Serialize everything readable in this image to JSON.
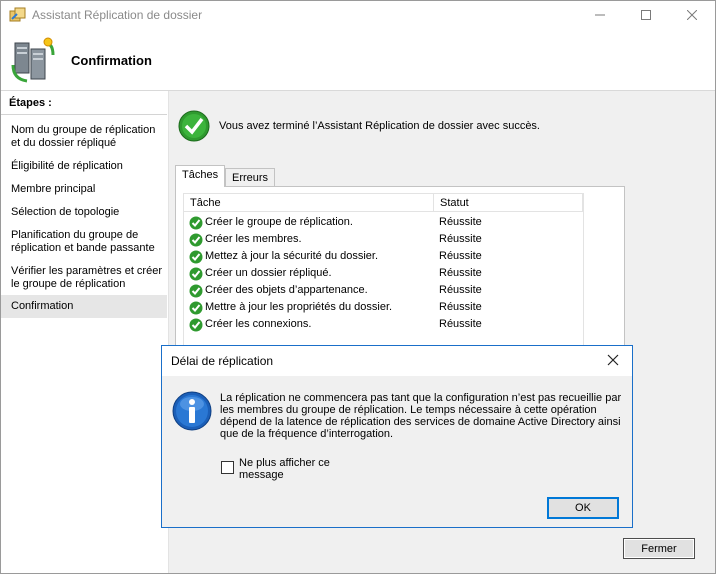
{
  "window": {
    "title": "Assistant Réplication de dossier",
    "minimize_icon": "minimize-icon",
    "maximize_icon": "maximize-icon",
    "close_icon": "close-icon"
  },
  "header": {
    "heading": "Confirmation",
    "icon": "replication-wizard-icon"
  },
  "sidebar": {
    "title": "Étapes :",
    "items": [
      {
        "label": "Nom du groupe de réplication et du dossier répliqué",
        "active": false
      },
      {
        "label": "Éligibilité de réplication",
        "active": false
      },
      {
        "label": "Membre principal",
        "active": false
      },
      {
        "label": "Sélection de topologie",
        "active": false
      },
      {
        "label": "Planification du groupe de réplication et bande passante",
        "active": false
      },
      {
        "label": "Vérifier les paramètres et créer le groupe de réplication",
        "active": false
      },
      {
        "label": "Confirmation",
        "active": true
      }
    ]
  },
  "main": {
    "success_message": "Vous avez terminé l’Assistant Réplication de dossier avec succès.",
    "success_icon": "success-check-icon",
    "tabs": [
      {
        "label": "Tâches",
        "selected": true
      },
      {
        "label": "Erreurs",
        "selected": false
      }
    ],
    "table": {
      "columns": [
        "Tâche",
        "Statut"
      ],
      "rows": [
        {
          "task": "Créer le groupe de réplication.",
          "status": "Réussite"
        },
        {
          "task": "Créer les membres.",
          "status": "Réussite"
        },
        {
          "task": "Mettez à jour la sécurité du dossier.",
          "status": "Réussite"
        },
        {
          "task": "Créer un dossier répliqué.",
          "status": "Réussite"
        },
        {
          "task": "Créer des objets d’appartenance.",
          "status": "Réussite"
        },
        {
          "task": "Mettre à jour les propriétés du dossier.",
          "status": "Réussite"
        },
        {
          "task": "Créer les connexions.",
          "status": "Réussite"
        }
      ]
    },
    "close_button": "Fermer"
  },
  "dialog": {
    "title": "Délai de réplication",
    "icon": "info-icon",
    "message": "La réplication ne commencera pas tant que la configuration n’est pas recueillie par les membres du groupe de réplication. Le temps nécessaire à cette opération dépend de la latence de réplication des services de domaine Active Directory ainsi que de la fréquence d’interrogation.",
    "checkbox_label": "Ne plus afficher ce message",
    "checkbox_checked": false,
    "ok_button": "OK"
  },
  "colors": {
    "accent": "#0078d7",
    "success_green": "#2f9a2f",
    "info_blue": "#1b5fb8"
  }
}
